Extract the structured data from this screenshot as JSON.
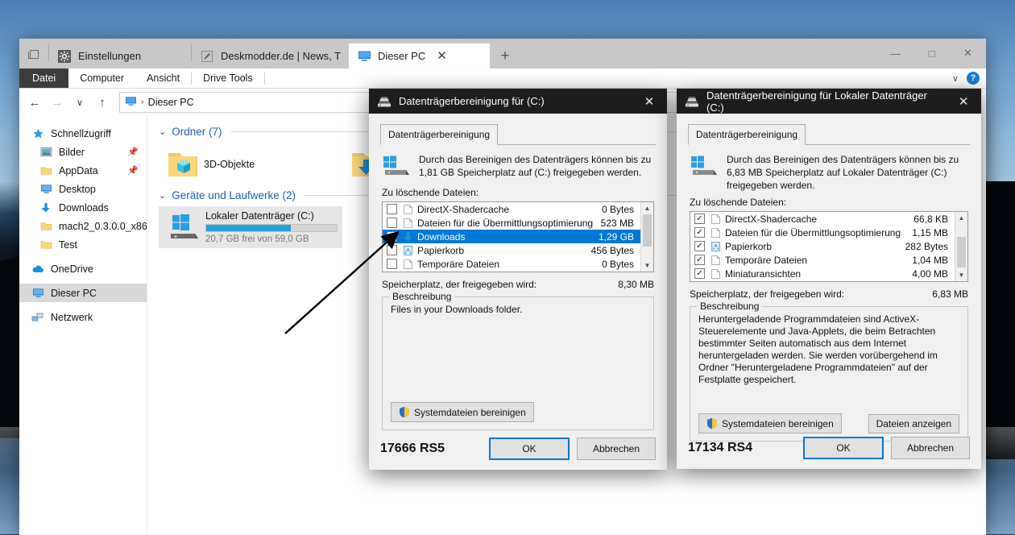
{
  "explorer": {
    "tabs": [
      {
        "label": "Einstellungen",
        "icon": "gear-icon",
        "active": false
      },
      {
        "label": "Deskmodder.de | News, Tip",
        "icon": "edit-icon",
        "active": false
      },
      {
        "label": "Dieser PC",
        "icon": "monitor-icon",
        "active": true
      }
    ],
    "new_tab_label": "+",
    "window_controls": {
      "minimize": "—",
      "maximize": "□",
      "close": "✕"
    },
    "ribbon_tabs": [
      "Datei",
      "Computer",
      "Ansicht",
      "Drive Tools"
    ],
    "ribbon_expand": "∨",
    "help_label": "?",
    "address": {
      "path": "Dieser PC",
      "icon": "monitor-icon",
      "separator": "›"
    },
    "nav_buttons": {
      "back": "←",
      "forward": "→",
      "recent": "∨",
      "up": "↑"
    },
    "sidebar": [
      {
        "label": "Schnellzugriff",
        "icon": "star-icon",
        "indent": false,
        "pinned": false,
        "selected": false
      },
      {
        "label": "Bilder",
        "icon": "pictures-icon",
        "indent": true,
        "pinned": true,
        "selected": false
      },
      {
        "label": "AppData",
        "icon": "folder-icon",
        "indent": true,
        "pinned": true,
        "selected": false
      },
      {
        "label": "Desktop",
        "icon": "desktop-icon",
        "indent": true,
        "pinned": false,
        "selected": false
      },
      {
        "label": "Downloads",
        "icon": "downloads-icon",
        "indent": true,
        "pinned": false,
        "selected": false
      },
      {
        "label": "mach2_0.3.0.0_x86",
        "icon": "folder-icon",
        "indent": true,
        "pinned": false,
        "selected": false
      },
      {
        "label": "Test",
        "icon": "folder-icon",
        "indent": true,
        "pinned": false,
        "selected": false
      },
      {
        "label": "OneDrive",
        "icon": "cloud-icon",
        "indent": false,
        "pinned": false,
        "selected": false
      },
      {
        "label": "Dieser PC",
        "icon": "monitor-icon",
        "indent": false,
        "pinned": false,
        "selected": true
      },
      {
        "label": "Netzwerk",
        "icon": "network-icon",
        "indent": false,
        "pinned": false,
        "selected": false
      }
    ],
    "groups": [
      {
        "title": "Ordner (7)",
        "items": [
          {
            "label": "3D-Objekte",
            "icon": "3d-objects-folder-icon"
          },
          {
            "label": "Downloads",
            "icon": "downloads-folder-icon"
          }
        ]
      },
      {
        "title": "Geräte und Laufwerke (2)",
        "items": []
      }
    ],
    "drive": {
      "name": "Lokaler Datenträger (C:)",
      "free_text": "20,7 GB frei von 59,0 GB",
      "used_percent": 65,
      "bar_color": "#26a0da",
      "icon": "windows-drive-icon"
    }
  },
  "dialog_left": {
    "title": "Datenträgerbereinigung für  (C:)",
    "title_icon": "disk-cleanup-icon",
    "close_label": "✕",
    "tab_label": "Datenträgerbereinigung",
    "header_text": "Durch das Bereinigen des Datenträgers können bis zu 1,81 GB Speicherplatz auf  (C:) freigegeben werden.",
    "list_label": "Zu löschende Dateien:",
    "items": [
      {
        "name": "DirectX-Shadercache",
        "size": "0 Bytes",
        "checked": false,
        "selected": false,
        "icon": "file-icon"
      },
      {
        "name": "Dateien für die Übermittlungsoptimierung",
        "size": "523 MB",
        "checked": false,
        "selected": false,
        "icon": "file-icon"
      },
      {
        "name": "Downloads",
        "size": "1,29 GB",
        "checked": false,
        "selected": true,
        "icon": "downloads-icon"
      },
      {
        "name": "Papierkorb",
        "size": "456 Bytes",
        "checked": false,
        "selected": false,
        "icon": "recycle-bin-icon"
      },
      {
        "name": "Temporäre Dateien",
        "size": "0 Bytes",
        "checked": false,
        "selected": false,
        "icon": "file-icon"
      }
    ],
    "total_label": "Speicherplatz, der freigegeben wird:",
    "total_value": "8,30 MB",
    "description_legend": "Beschreibung",
    "description_text": "Files in your Downloads folder.",
    "clean_system_button": "Systemdateien bereinigen",
    "build": "17666 RS5",
    "ok_button": "OK",
    "cancel_button": "Abbrechen"
  },
  "dialog_right": {
    "title": "Datenträgerbereinigung für Lokaler Datenträger (C:)",
    "title_icon": "disk-cleanup-icon",
    "close_label": "✕",
    "tab_label": "Datenträgerbereinigung",
    "header_text": "Durch das Bereinigen des Datenträgers können bis zu 6,83 MB Speicherplatz auf Lokaler Datenträger (C:) freigegeben werden.",
    "list_label": "Zu löschende Dateien:",
    "items": [
      {
        "name": "DirectX-Shadercache",
        "size": "66,8 KB",
        "checked": true,
        "selected": false,
        "icon": "file-icon"
      },
      {
        "name": "Dateien für die Übermittlungsoptimierung",
        "size": "1,15 MB",
        "checked": true,
        "selected": false,
        "icon": "file-icon"
      },
      {
        "name": "Papierkorb",
        "size": "282 Bytes",
        "checked": true,
        "selected": false,
        "icon": "recycle-bin-icon"
      },
      {
        "name": "Temporäre Dateien",
        "size": "1,04 MB",
        "checked": true,
        "selected": false,
        "icon": "file-icon"
      },
      {
        "name": "Miniaturansichten",
        "size": "4,00 MB",
        "checked": true,
        "selected": false,
        "icon": "file-icon"
      }
    ],
    "total_label": "Speicherplatz, der freigegeben wird:",
    "total_value": "6,83 MB",
    "description_legend": "Beschreibung",
    "description_text": "Heruntergeladende Programmdateien sind ActiveX-Steuerelemente und Java-Applets, die beim Betrachten bestimmter Seiten automatisch aus dem Internet heruntergeladen werden. Sie werden vorübergehend im Ordner \"Heruntergeladene Programmdateien\" auf der Festplatte gespeichert.",
    "clean_system_button": "Systemdateien bereinigen",
    "view_files_button": "Dateien anzeigen",
    "build": "17134 RS4",
    "ok_button": "OK",
    "cancel_button": "Abbrechen"
  },
  "annotation": {
    "type": "arrow",
    "color": "#000000",
    "points_to": "Downloads row in left dialog"
  }
}
